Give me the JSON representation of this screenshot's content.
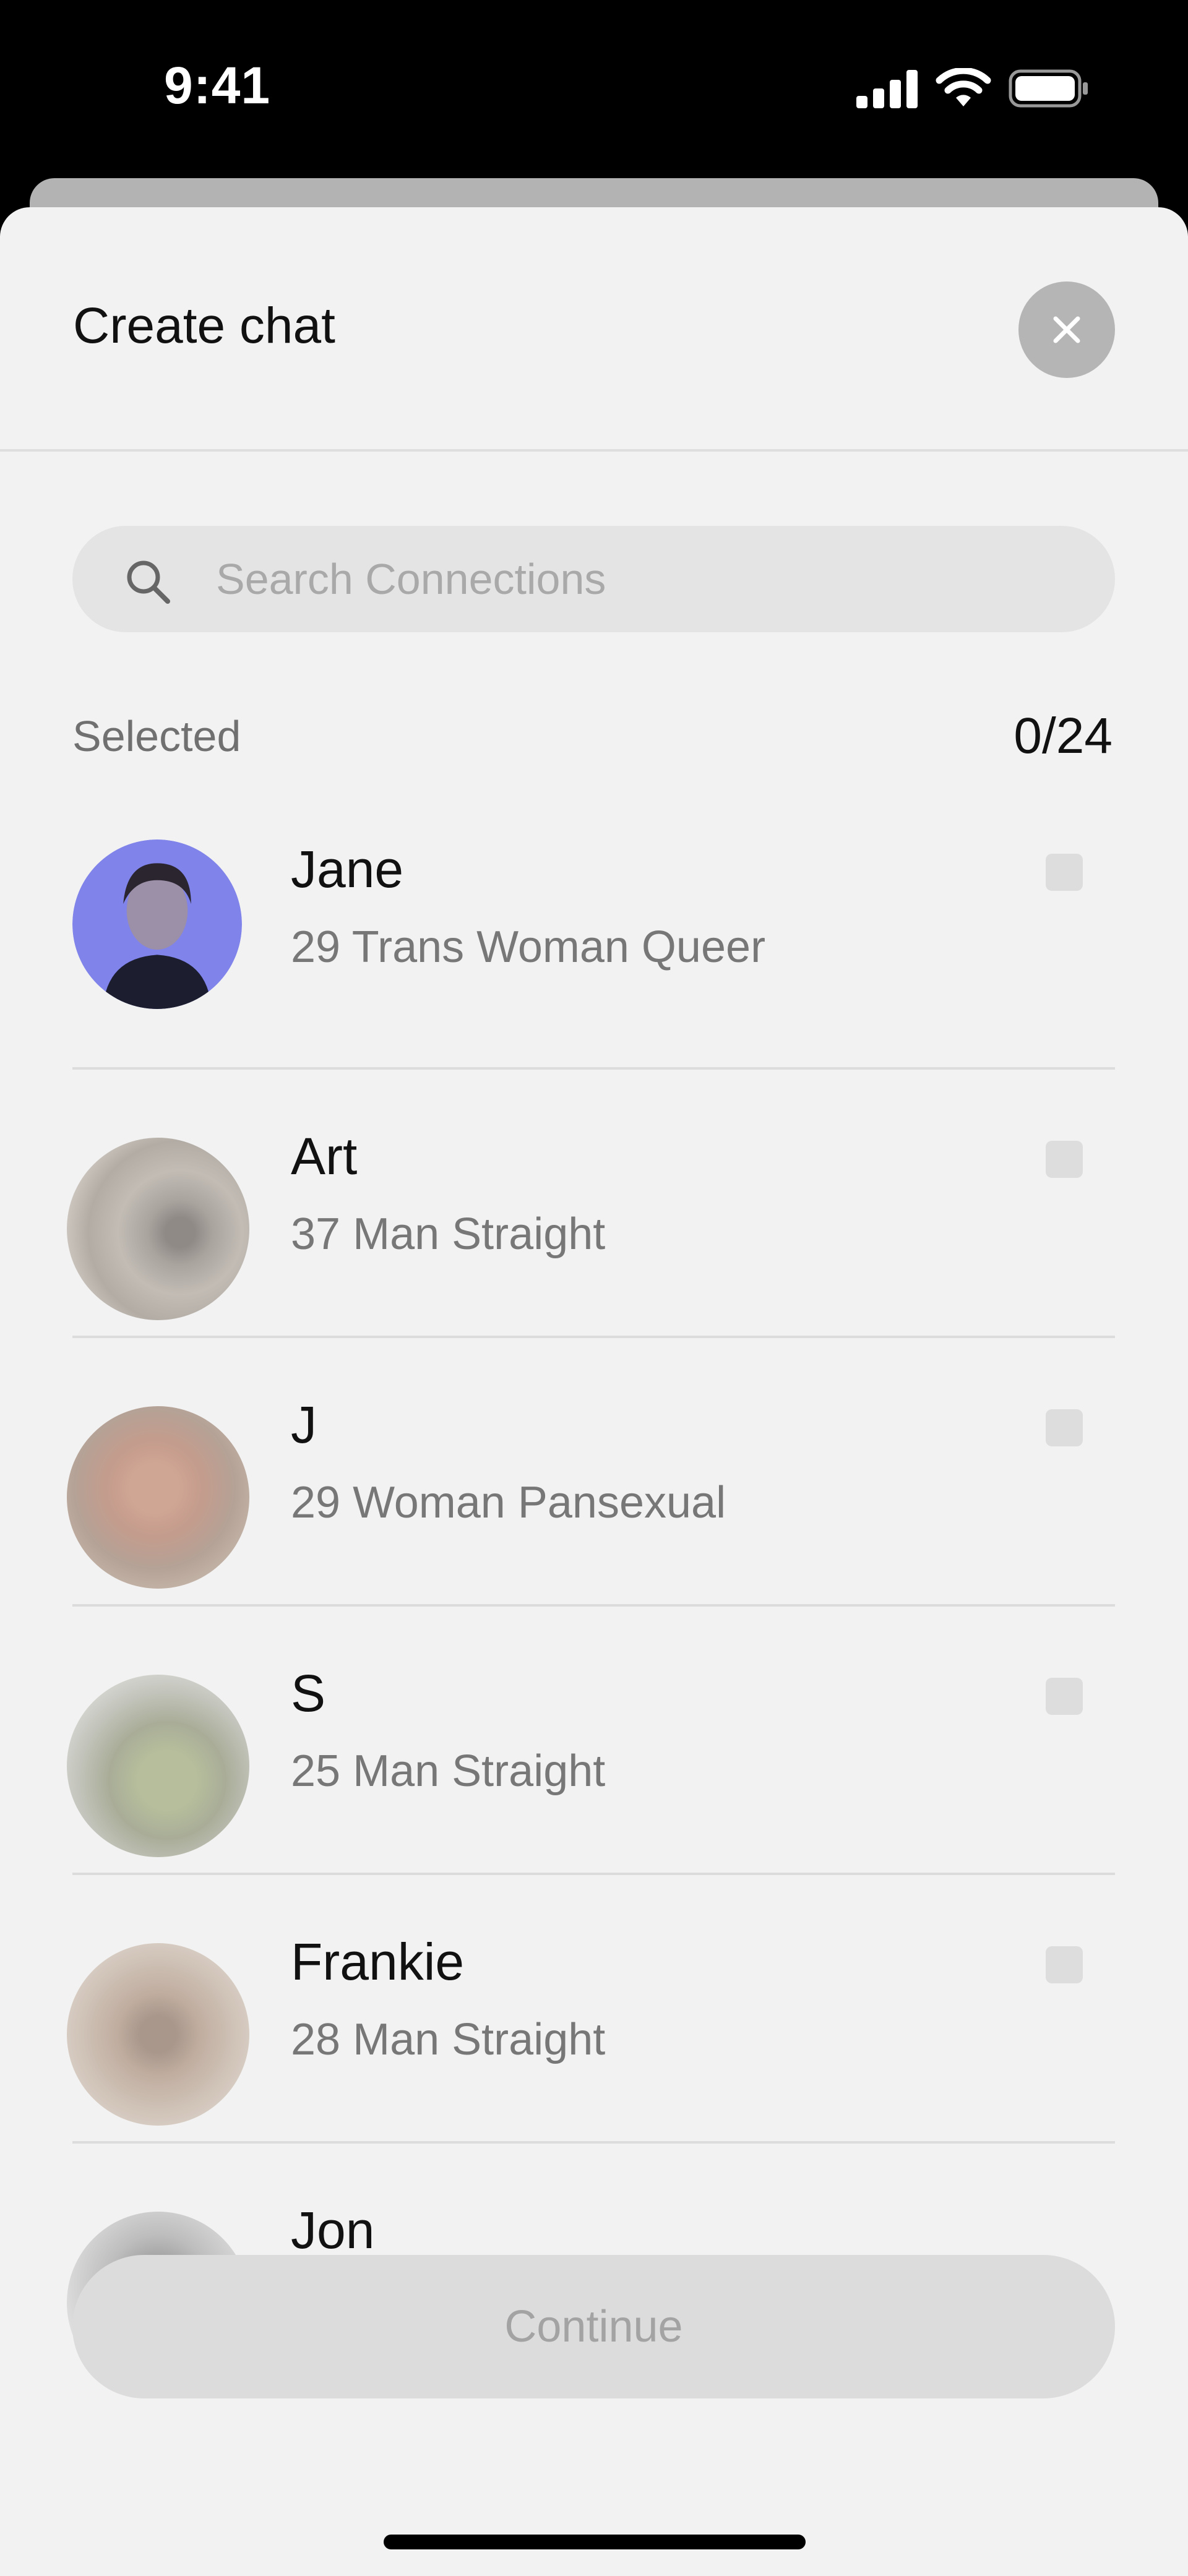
{
  "status_bar": {
    "time": "9:41"
  },
  "header": {
    "title": "Create chat"
  },
  "search": {
    "placeholder": "Search Connections"
  },
  "selection": {
    "label": "Selected",
    "count": "0/24"
  },
  "contacts": [
    {
      "name": "Jane",
      "details": "29 Trans Woman Queer"
    },
    {
      "name": "Art",
      "details": "37 Man Straight"
    },
    {
      "name": "J",
      "details": "29 Woman Pansexual"
    },
    {
      "name": "S",
      "details": "25 Man Straight"
    },
    {
      "name": "Frankie",
      "details": "28 Man Straight"
    },
    {
      "name": "Jon",
      "details": ""
    }
  ],
  "footer": {
    "continue_label": "Continue"
  },
  "colors": {
    "sheet_bg": "#f2f2f2",
    "close_bg": "#b5b5b5",
    "disabled_button": "#dcdcdc"
  }
}
